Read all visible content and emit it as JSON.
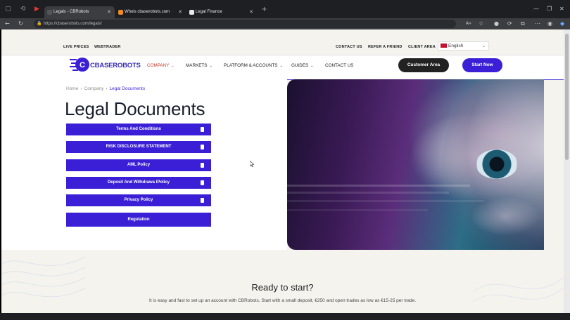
{
  "browser": {
    "tabs": [
      {
        "title": "Legals - CBRobots"
      },
      {
        "title": "Whois cbaserobots.com"
      },
      {
        "title": "Legal Finance"
      }
    ],
    "url": "https://cbaserobots.com/legals/"
  },
  "topbar": {
    "left_links": [
      "LIVE PRICES",
      "WEBTRADER"
    ],
    "right_links": [
      "CONTACT US",
      "REFER A FRIEND",
      "CLIENT AREA"
    ],
    "language": "English"
  },
  "nav": {
    "logo_text": "CBASEROBOTS",
    "items": [
      "COMPANY",
      "MARKETS",
      "PLATFORM & ACCOUNTS",
      "GUIDES",
      "CONTACT US"
    ],
    "customer_area": "Customer Area",
    "start_now": "Start Now"
  },
  "breadcrumb": [
    "Home",
    "Company",
    "Legal Documents"
  ],
  "page_title": "Legal Documents",
  "documents": [
    "Terms And Conditions",
    "RISK DISCLOSURE STATEMENT",
    "AML Policy",
    "Deposit And Withdrawa lPolicy",
    "Privacy Policy",
    "Regulation"
  ],
  "cta": {
    "title": "Ready to start?",
    "subtitle": "It is easy and fast to set up an account with CBRobots. Start with a small deposit, €250 and open trades as low as €15-25 per trade."
  },
  "colors": {
    "brand": "#3b1fd6",
    "dark_button": "#222222",
    "active_nav": "#c0392b"
  }
}
